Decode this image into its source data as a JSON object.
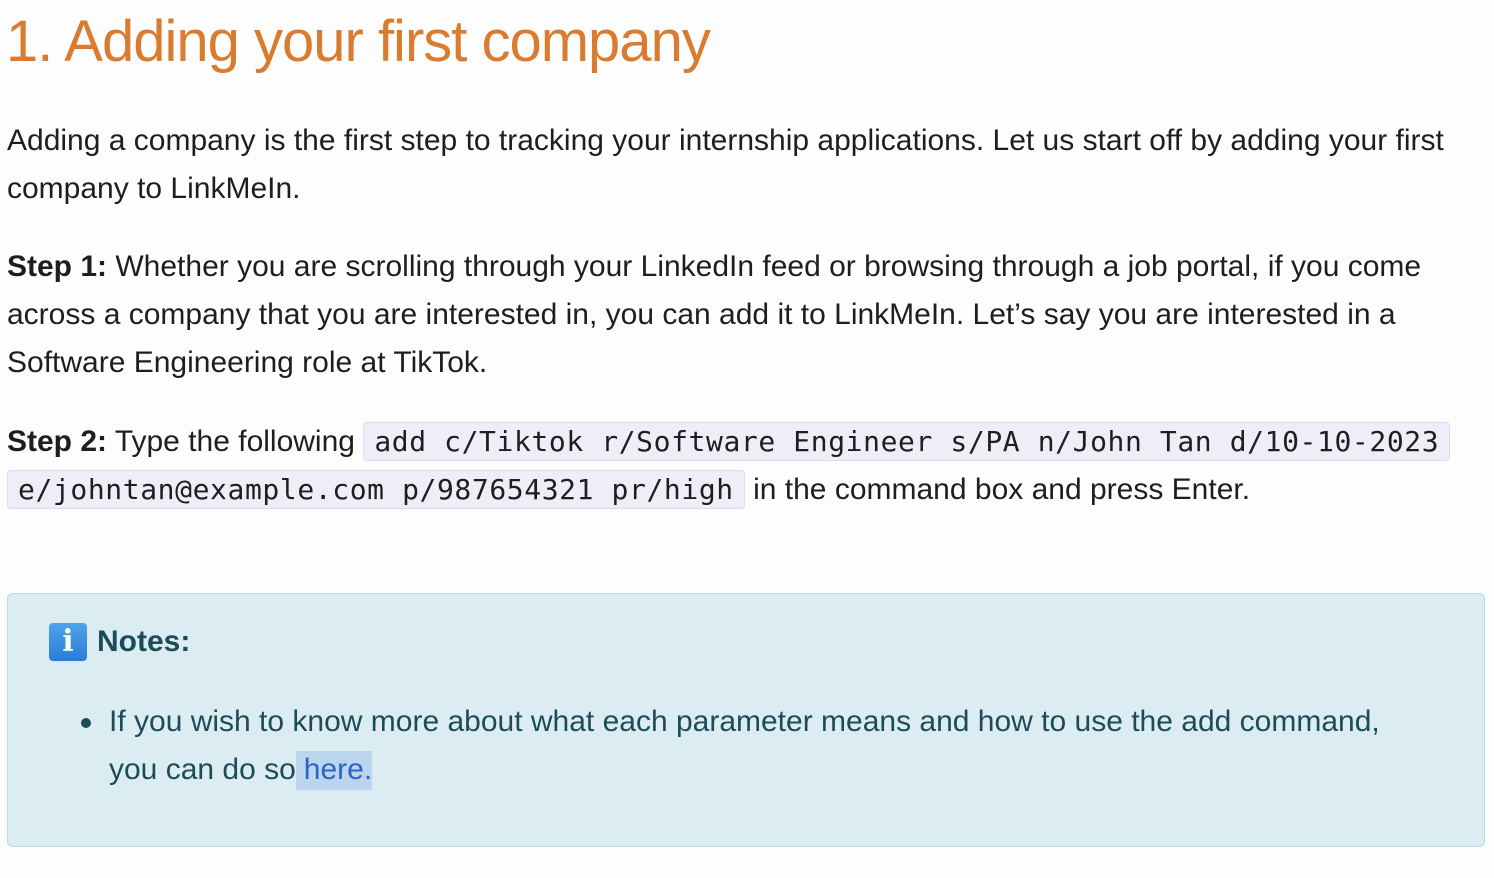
{
  "section": {
    "title": "1. Adding your first company",
    "intro": "Adding a company is the first step to tracking your internship applications. Let us start off by adding your first company to LinkMeIn."
  },
  "step1": {
    "label": "Step 1:",
    "text": " Whether you are scrolling through your LinkedIn feed or browsing through a job portal, if you come across a company that you are interested in, you can add it to LinkMeIn. Let’s say you are interested in a Software Engineering role at TikTok."
  },
  "step2": {
    "label": "Step 2:",
    "text_before": " Type the following ",
    "command": "add c/Tiktok r/Software Engineer s/PA n/John Tan d/10-10-2023 e/johntan@example.com p/987654321 pr/high",
    "text_after": " in the command box and press Enter."
  },
  "notes": {
    "icon": "info-icon",
    "icon_glyph": "i",
    "title": "Notes:",
    "items": [
      {
        "text": "If you wish to know more about what each parameter means and how to use the add command, you can do so",
        "link_text": "here."
      }
    ]
  },
  "colors": {
    "heading": "#d97c2f",
    "notes_background": "#dbedf3",
    "notes_text": "#1e4b58",
    "link": "#2e63c6"
  }
}
